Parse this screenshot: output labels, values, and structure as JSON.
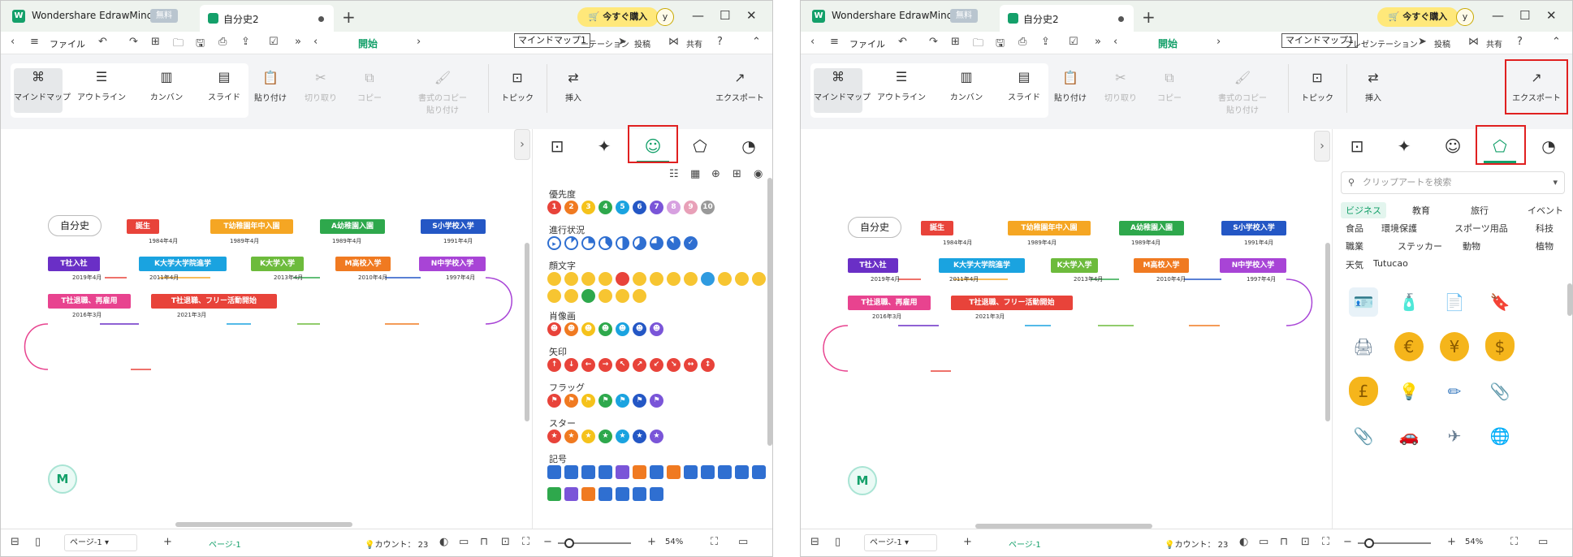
{
  "app": {
    "name": "Wondershare EdrawMind",
    "free_badge": "無料",
    "doc_title": "自分史2",
    "buy_label": "今すぐ購入",
    "avatar_letter": "y"
  },
  "toolbar": {
    "file_label": "ファイル",
    "start_tab": "開始",
    "tooltip_left": "マインドマップ1",
    "tooltip_right": "マインドマップ1",
    "presentation_left": "ーテーション",
    "presentation_right": "プレゼンテーション",
    "post": "投稿",
    "share": "共有"
  },
  "ribbon": {
    "views": [
      "マインドマップ",
      "アウトライン",
      "カンバン",
      "スライド"
    ],
    "paste": "貼り付け",
    "cut": "切り取り",
    "copy": "コピー",
    "format_copy_1": "書式のコピー",
    "format_copy_2": "貼り付け",
    "topic": "トピック",
    "insert": "挿入",
    "export": "エクスポート"
  },
  "mindmap": {
    "root": "自分史",
    "row1": [
      {
        "label": "誕生",
        "date": "1984年4月",
        "color": "#e8433a"
      },
      {
        "label": "T幼稚園年中入園",
        "date": "1989年4月",
        "color": "#f5a623"
      },
      {
        "label": "A幼稚園入園",
        "date": "1989年4月",
        "color": "#2ea84c"
      },
      {
        "label": "S小学校入学",
        "date": "1991年4月",
        "color": "#2457c5"
      }
    ],
    "row2": [
      {
        "label": "T社入社",
        "date": "2019年4月",
        "color": "#6a2fc6"
      },
      {
        "label": "K大学大学院進学",
        "date": "2011年4月",
        "color": "#1aa3e0"
      },
      {
        "label": "K大学入学",
        "date": "2013年4月",
        "color": "#6dbb3c"
      },
      {
        "label": "M高校入学",
        "date": "2010年4月",
        "color": "#f07a21"
      },
      {
        "label": "N中学校入学",
        "date": "1997年4月",
        "color": "#a844d6"
      }
    ],
    "row3": [
      {
        "label": "T社退職、再雇用",
        "date": "2016年3月",
        "color": "#e8438f"
      },
      {
        "label": "T社退職、フリー活動開始",
        "date": "2021年3月",
        "color": "#e8433a"
      }
    ]
  },
  "left_panel": {
    "sections": [
      "優先度",
      "進行状況",
      "顔文字",
      "肖像画",
      "矢印",
      "フラッグ",
      "スター",
      "記号"
    ],
    "priority_numbers": [
      "1",
      "2",
      "3",
      "4",
      "5",
      "6",
      "7",
      "8",
      "9",
      "10"
    ]
  },
  "right_panel": {
    "search_placeholder": "クリップアートを検索",
    "categories": [
      [
        "ビジネス",
        "教育",
        "旅行",
        "イベント"
      ],
      [
        "食品",
        "環境保護",
        "スポーツ用品",
        "科技"
      ],
      [
        "職業",
        "ステッカー",
        "動物",
        "植物"
      ],
      [
        "天気",
        "Tutucao"
      ]
    ],
    "clipart_icons": [
      "id-badge-icon",
      "glue-bottle-icon",
      "document-icon",
      "stamp-icon",
      "printer-icon",
      "euro-coin-icon",
      "yen-coin-icon",
      "dollar-bag-icon",
      "pound-bag-icon",
      "desk-lamp-icon",
      "pencil-icon",
      "stapler-icon",
      "binder-clip-icon",
      "car-icon",
      "airplane-icon",
      "globe-icon"
    ]
  },
  "status": {
    "page_select": "ページ-1",
    "page_tab": "ページ-1",
    "count_label": "カウント：",
    "count_value": "23",
    "zoom": "54%"
  }
}
